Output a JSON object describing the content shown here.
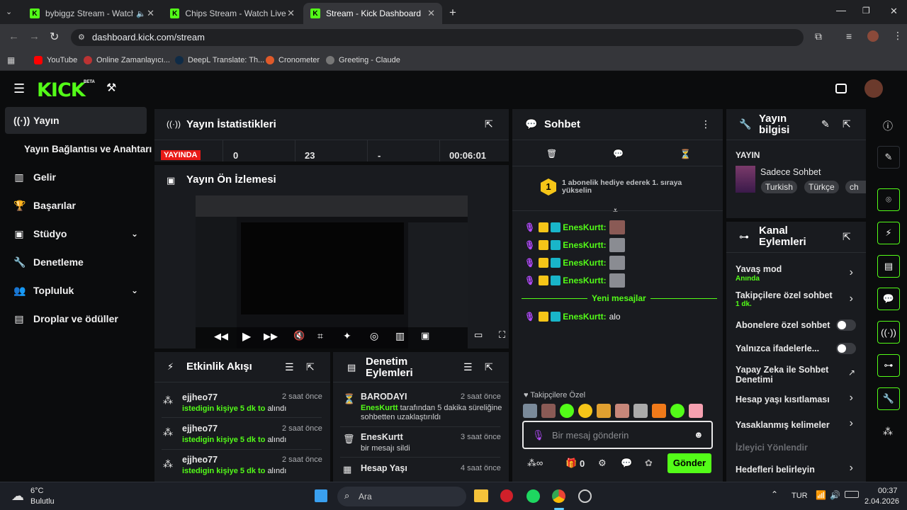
{
  "browser": {
    "tabs": [
      {
        "title": "bybiggz Stream - Watch Liv",
        "active": false
      },
      {
        "title": "Chips Stream - Watch Live on K",
        "active": false
      },
      {
        "title": "Stream - Kick Dashboard",
        "active": true
      }
    ],
    "url": "dashboard.kick.com/stream",
    "bookmarks": [
      "YouTube",
      "Online Zamanlayıcı...",
      "DeepL Translate: Th...",
      "Cronometer",
      "Greeting - Claude"
    ]
  },
  "header": {
    "logo": "KICK",
    "beta": "BETA"
  },
  "sidebar": {
    "items": [
      {
        "label": "Yayın",
        "icon": "broadcast-icon"
      },
      {
        "label": "Yayın Bağlantısı ve Anahtarı",
        "icon": ""
      },
      {
        "label": "Gelir",
        "icon": "chart-icon"
      },
      {
        "label": "Başarılar",
        "icon": "trophy-icon"
      },
      {
        "label": "Stüdyo",
        "icon": "studio-icon"
      },
      {
        "label": "Denetleme",
        "icon": "wrench-icon"
      },
      {
        "label": "Topluluk",
        "icon": "users-icon"
      },
      {
        "label": "Droplar ve ödüller",
        "icon": "gift-icon"
      }
    ]
  },
  "stats": {
    "title": "Yayın İstatistikleri",
    "live_badge": "YAYINDA",
    "values": [
      "0",
      "23",
      "-",
      "00:06:01"
    ]
  },
  "preview": {
    "title": "Yayın Ön İzlemesi"
  },
  "activity": {
    "title": "Etkinlik Akışı",
    "items": [
      {
        "user": "ejjheo77",
        "time": "2 saat önce",
        "desc_green": "istedigin kişiye 5 dk to",
        "desc_rest": "alındı"
      },
      {
        "user": "ejjheo77",
        "time": "2 saat önce",
        "desc_green": "istedigin kişiye 5 dk to",
        "desc_rest": "alındı"
      },
      {
        "user": "ejjheo77",
        "time": "2 saat önce",
        "desc_green": "istedigin kişiye 5 dk to",
        "desc_rest": "alındı"
      }
    ]
  },
  "moderation": {
    "title": "Denetim Eylemleri",
    "items": [
      {
        "user": "BARODAYI",
        "time": "2 saat önce",
        "desc_green": "EnesKurtt",
        "desc_rest": "tarafından 5 dakika süreliğine sohbetten uzaklaştırıldı"
      },
      {
        "user": "EnesKurtt",
        "time": "3 saat önce",
        "desc_green": "",
        "desc_rest": "bir mesajı sildi"
      },
      {
        "user": "Hesap Yaşı",
        "time": "4 saat önce",
        "desc_green": "",
        "desc_rest": ""
      }
    ]
  },
  "chat": {
    "title": "Sohbet",
    "gift_banner": "1 abonelik hediye ederek 1. sıraya yükselin",
    "gift_rank": "1",
    "messages": [
      {
        "user": "EnesKurtt:",
        "text": ""
      },
      {
        "user": "EnesKurtt:",
        "text": ""
      },
      {
        "user": "EnesKurtt:",
        "text": ""
      },
      {
        "user": "EnesKurtt:",
        "text": ""
      }
    ],
    "new_messages": "Yeni mesajlar",
    "last_message": {
      "user": "EnesKurtt:",
      "text": "alo"
    },
    "followers_only": "Takipçilere Özel",
    "input_placeholder": "Bir mesaj gönderin",
    "send_label": "Gönder",
    "count": "0"
  },
  "stream_info": {
    "title": "Yayın bilgisi",
    "status": "YAYIN",
    "category": "Sadece Sohbet",
    "tags": [
      "Turkish",
      "Türkçe",
      "ch"
    ]
  },
  "channel_actions": {
    "title": "Kanal Eylemleri",
    "items": [
      {
        "label": "Yavaş mod",
        "sub": "Anında",
        "control": "chevron"
      },
      {
        "label": "Takipçilere özel sohbet",
        "sub": "1 dk.",
        "control": "chevron"
      },
      {
        "label": "Abonelere özel sohbet",
        "sub": "",
        "control": "toggle"
      },
      {
        "label": "Yalnızca ifadelerle...",
        "sub": "",
        "control": "toggle"
      },
      {
        "label": "Yapay Zeka ile Sohbet Denetimi",
        "sub": "",
        "control": "external"
      },
      {
        "label": "Hesap yaşı kısıtlaması",
        "sub": "",
        "control": "chevron"
      },
      {
        "label": "Yasaklanmış kelimeler",
        "sub": "",
        "control": "chevron"
      },
      {
        "label": "İzleyici Yönlendir",
        "sub": "",
        "control": "none"
      },
      {
        "label": "Hedefleri belirleyin",
        "sub": "",
        "control": "chevron"
      }
    ]
  },
  "taskbar": {
    "weather_temp": "6°C",
    "weather_desc": "Bulutlu",
    "search_placeholder": "Ara",
    "lang": "TUR",
    "time": "00:37",
    "date": "2.04.2026"
  },
  "colors": {
    "accent": "#53fc18",
    "panel": "#191b1f",
    "live": "#e91916"
  }
}
